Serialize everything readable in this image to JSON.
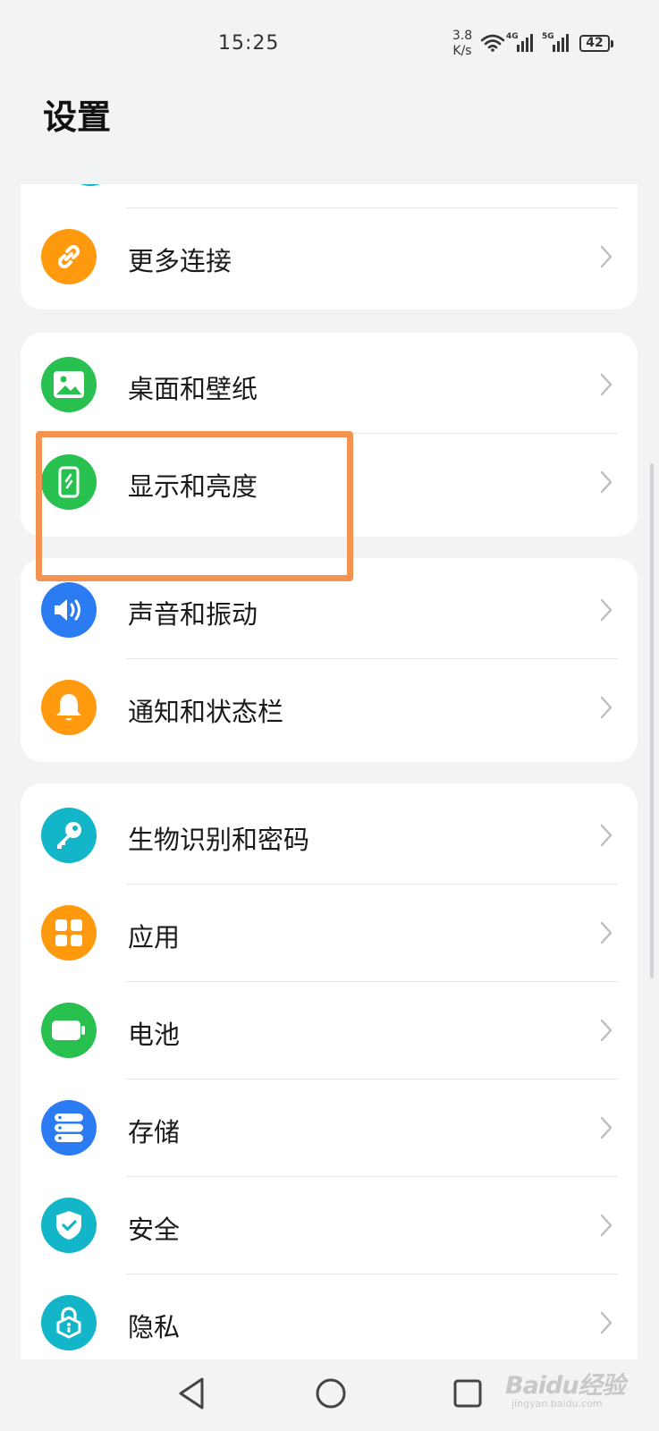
{
  "status_bar": {
    "time": "15:25",
    "net_speed_value": "3.8",
    "net_speed_unit": "K/s",
    "sim1_tag": "4G",
    "sim2_tag": "5G",
    "battery_level": "42"
  },
  "page": {
    "title": "设置"
  },
  "groups": [
    {
      "items": [
        {
          "label": "更多连接",
          "icon": "link-icon",
          "color": "#ff9a0f"
        }
      ]
    },
    {
      "items": [
        {
          "label": "桌面和壁纸",
          "icon": "image-icon",
          "color": "#28c04f"
        },
        {
          "label": "显示和亮度",
          "icon": "display-brightness-icon",
          "color": "#28c04f"
        }
      ]
    },
    {
      "items": [
        {
          "label": "声音和振动",
          "icon": "speaker-icon",
          "color": "#2b7bf3"
        },
        {
          "label": "通知和状态栏",
          "icon": "bell-icon",
          "color": "#ff9a0f"
        }
      ]
    },
    {
      "items": [
        {
          "label": "生物识别和密码",
          "icon": "key-icon",
          "color": "#13b6c9"
        },
        {
          "label": "应用",
          "icon": "apps-grid-icon",
          "color": "#ff9a0f"
        },
        {
          "label": "电池",
          "icon": "battery-icon",
          "color": "#28c04f"
        },
        {
          "label": "存储",
          "icon": "storage-icon",
          "color": "#2b7bf3"
        },
        {
          "label": "安全",
          "icon": "shield-check-icon",
          "color": "#13b6c9"
        },
        {
          "label": "隐私",
          "icon": "privacy-lock-icon",
          "color": "#13b6c9"
        }
      ]
    }
  ],
  "highlight_color": "#f4924f",
  "nav": {
    "back": "back-icon",
    "home": "home-icon",
    "recents": "recents-icon"
  },
  "watermark": {
    "main": "Baidu经验",
    "sub": "jingyan.baidu.com"
  }
}
